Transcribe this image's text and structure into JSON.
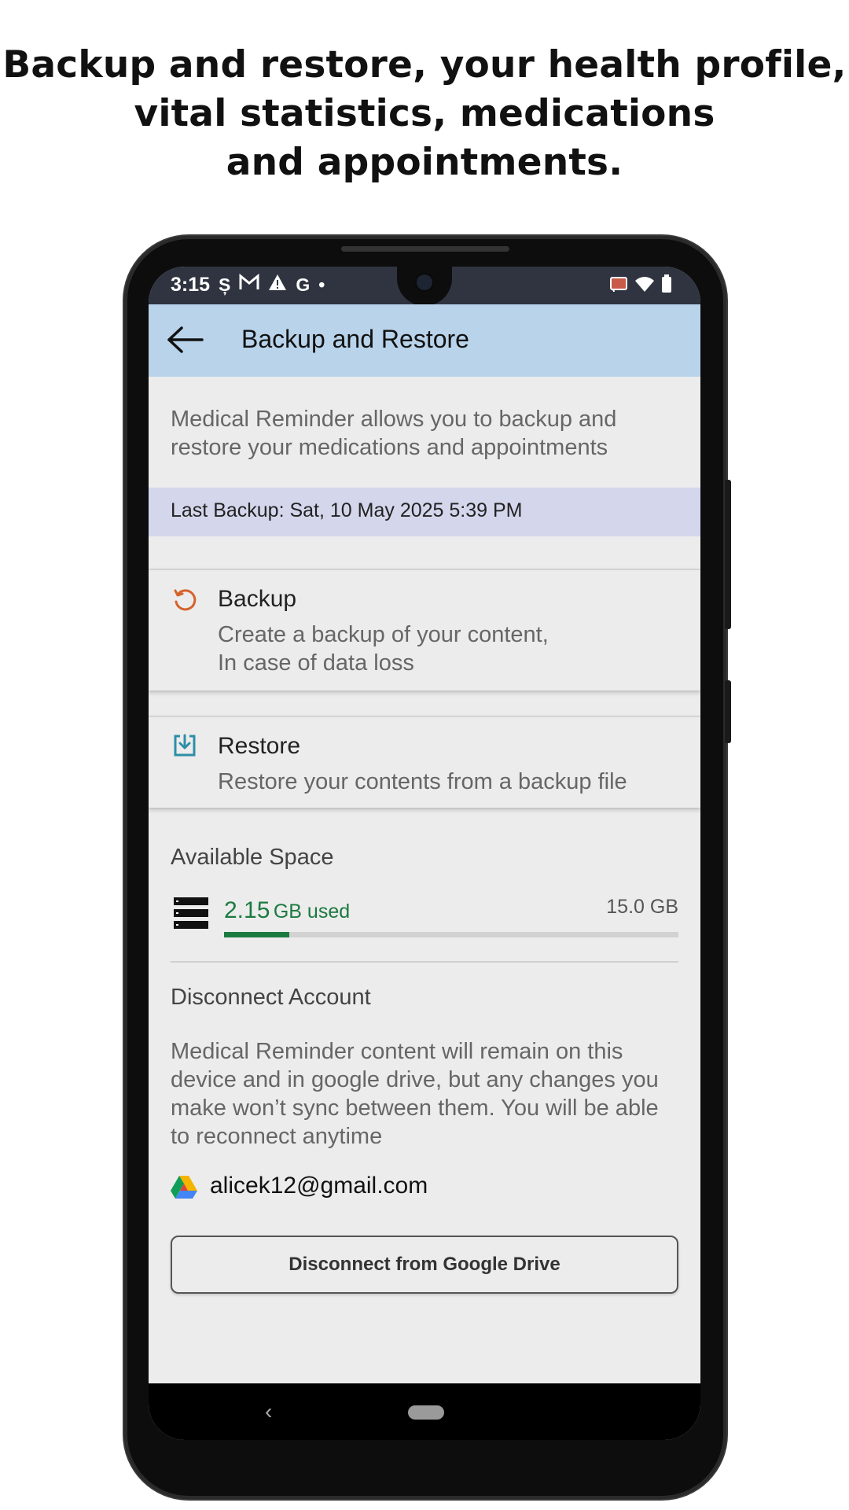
{
  "headline": {
    "line1": "Backup and restore, your health profile,",
    "line2": "vital statistics, medications",
    "line3": "and appointments."
  },
  "status_bar": {
    "time": "3:15",
    "left_icons": [
      "s-icon",
      "gmail-icon",
      "alert-icon",
      "google-icon",
      "dot-icon"
    ],
    "right_icons": [
      "cast-icon",
      "wifi-icon",
      "battery-icon"
    ]
  },
  "app_bar": {
    "title": "Backup and Restore"
  },
  "intro_text": "Medical Reminder allows you to backup and restore your medications and appointments",
  "last_backup": "Last Backup: Sat, 10 May 2025  5:39 PM",
  "backup_card": {
    "title": "Backup",
    "subtitle_line1": "Create a backup of your content,",
    "subtitle_line2": "In case of data loss",
    "icon": "backup-restore-icon",
    "icon_color": "#d5622b"
  },
  "restore_card": {
    "title": "Restore",
    "subtitle": "Restore your contents from a backup file",
    "icon": "download-icon",
    "icon_color": "#2e8ea8"
  },
  "storage": {
    "title": "Available Space",
    "used_value": "2.15",
    "used_unit": "GB used",
    "total": "15.0 GB",
    "used_fraction": 0.143,
    "accent_color": "#1b7a40"
  },
  "disconnect": {
    "title": "Disconnect Account",
    "description": "Medical Reminder content will remain on this device and in google drive, but any changes you make won’t sync between them. You will be able to reconnect anytime",
    "email": "alicek12@gmail.com",
    "button_label": "Disconnect from Google Drive"
  }
}
